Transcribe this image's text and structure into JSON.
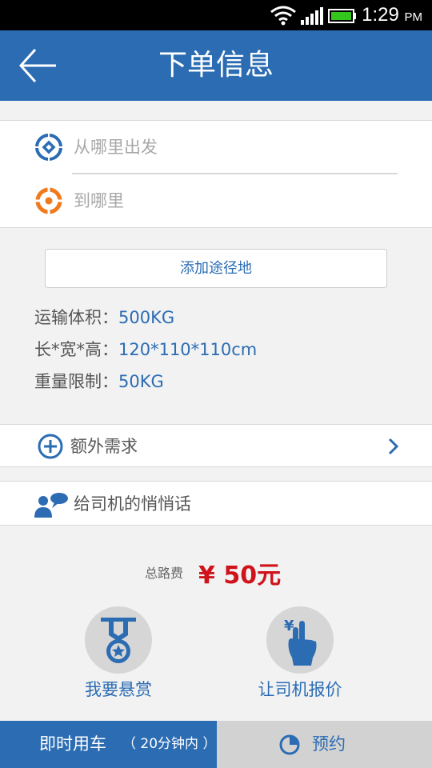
{
  "status_bar": {
    "time": "1:29",
    "ampm": "PM"
  },
  "header": {
    "title": "下单信息"
  },
  "route": {
    "from_placeholder": "从哪里出发",
    "to_placeholder": "到哪里"
  },
  "add_stop_label": "添加途径地",
  "specs": {
    "volume_label": "运输体积：",
    "volume_value": "500KG",
    "dims_label": "长*宽*高：",
    "dims_value": "120*110*110cm",
    "weight_label": "重量限制：",
    "weight_value": "50KG"
  },
  "extra_label": "额外需求",
  "message_label": "给司机的悄悄话",
  "fee": {
    "label": "总路费",
    "value": "¥ 50元"
  },
  "options": {
    "reward_label": "我要悬赏",
    "quote_label": "让司机报价"
  },
  "bottom": {
    "now_label": "即时用车",
    "now_sub": "（ 20分钟内 ）",
    "book_label": "预约"
  },
  "colors": {
    "primary": "#2b6cb3",
    "price": "#d0121b",
    "orange": "#f07a1e"
  }
}
